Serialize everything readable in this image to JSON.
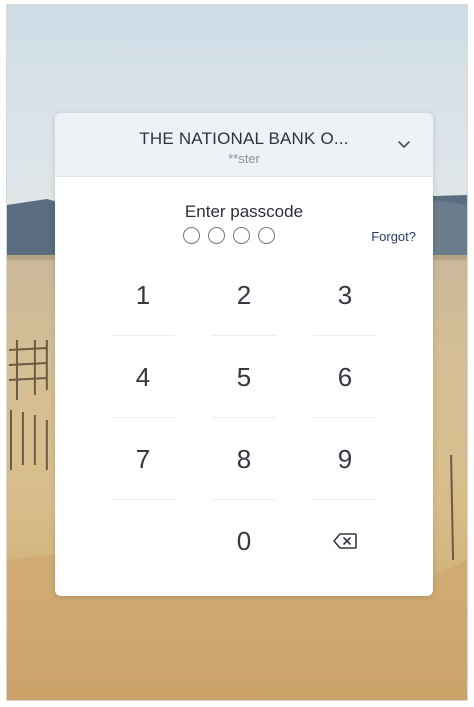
{
  "header": {
    "bank_name": "THE NATIONAL BANK O...",
    "account_masked": "**ster"
  },
  "passcode": {
    "prompt": "Enter passcode",
    "digits_entered": 0,
    "digits_total": 4,
    "forgot_label": "Forgot?"
  },
  "keypad": {
    "k1": "1",
    "k2": "2",
    "k3": "3",
    "k4": "4",
    "k5": "5",
    "k6": "6",
    "k7": "7",
    "k8": "8",
    "k9": "9",
    "k0": "0"
  },
  "icons": {
    "dropdown": "chevron-down-icon",
    "delete": "backspace-icon"
  },
  "colors": {
    "header_bg": "#eef1f6",
    "bank_name_text": "#2a3346",
    "link": "#243c6a"
  }
}
